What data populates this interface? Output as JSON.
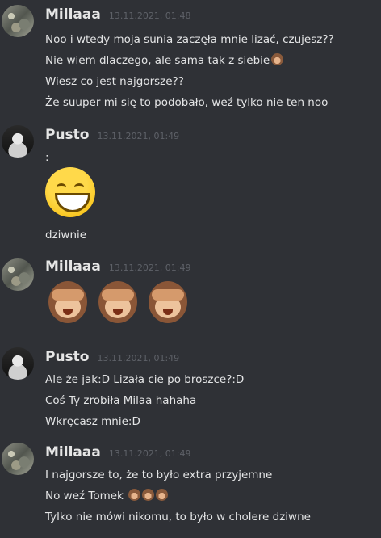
{
  "messages": [
    {
      "author": "Millaaa",
      "timestamp": "13.11.2021, 01:48",
      "avatar": "millaa-avatar",
      "lines": [
        "Noo i wtedy moja sunia zaczęła mnie lizać, czujesz??",
        "Nie wiem dlaczego, ale sama tak z siebie",
        "Wiesz co jest najgorsze??",
        "Że suuper mi się to podobało, weź tylko nie ten noo"
      ]
    },
    {
      "author": "Pusto",
      "timestamp": "13.11.2021, 01:49",
      "avatar": "pusto-avatar",
      "lines": [
        ":",
        "dziwnie"
      ],
      "emoji": "grinning-face"
    },
    {
      "author": "Millaaa",
      "timestamp": "13.11.2021, 01:49",
      "avatar": "millaa-avatar",
      "emoji": "see-no-evil-monkey x3"
    },
    {
      "author": "Pusto",
      "timestamp": "13.11.2021, 01:49",
      "avatar": "pusto-avatar",
      "lines": [
        "Ale że jak:D Lizała cie po broszce?:D",
        "Coś Ty zrobiła Milaa hahaha",
        "Wkręcasz mnie:D"
      ]
    },
    {
      "author": "Millaaa",
      "timestamp": "13.11.2021, 01:49",
      "avatar": "millaa-avatar",
      "lines": [
        "I najgorsze to, że to było extra przyjemne",
        "No weź Tomek",
        "Tylko nie mówi nikomu, to było w cholere dziwne"
      ]
    }
  ]
}
